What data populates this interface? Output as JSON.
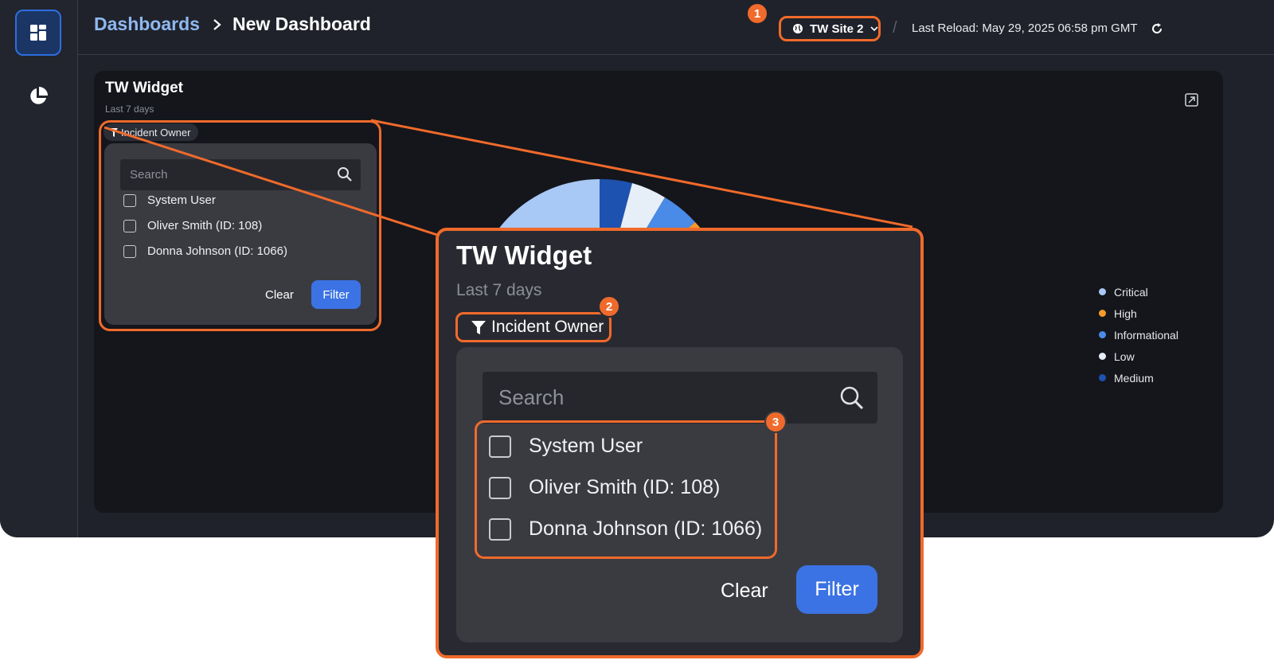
{
  "breadcrumb": {
    "root": "Dashboards",
    "current": "New Dashboard"
  },
  "header": {
    "site_label": "TW Site 2",
    "last_reload": "Last Reload: May 29, 2025 06:58 pm GMT",
    "separator": "/"
  },
  "widget": {
    "title": "TW Widget",
    "subtitle": "Last 7 days",
    "filter_chip": "Incident Owner"
  },
  "filter_popup": {
    "search_placeholder": "Search",
    "options": [
      "System User",
      "Oliver Smith (ID: 108)",
      "Donna Johnson (ID: 1066)"
    ],
    "clear_label": "Clear",
    "filter_label": "Filter"
  },
  "callouts": {
    "one": "1",
    "two": "2",
    "three": "3"
  },
  "chart_data": {
    "type": "pie",
    "legend": [
      "Critical",
      "High",
      "Informational",
      "Low",
      "Medium"
    ],
    "colors": {
      "Critical": "#a8c8f5",
      "High": "#f39a2b",
      "Informational": "#4a8be8",
      "Low": "#e6eef8",
      "Medium": "#1e52b0"
    }
  },
  "colors": {
    "accent": "#f06a2b",
    "primary_button": "#3b73e4",
    "link": "#8fb8f0"
  }
}
